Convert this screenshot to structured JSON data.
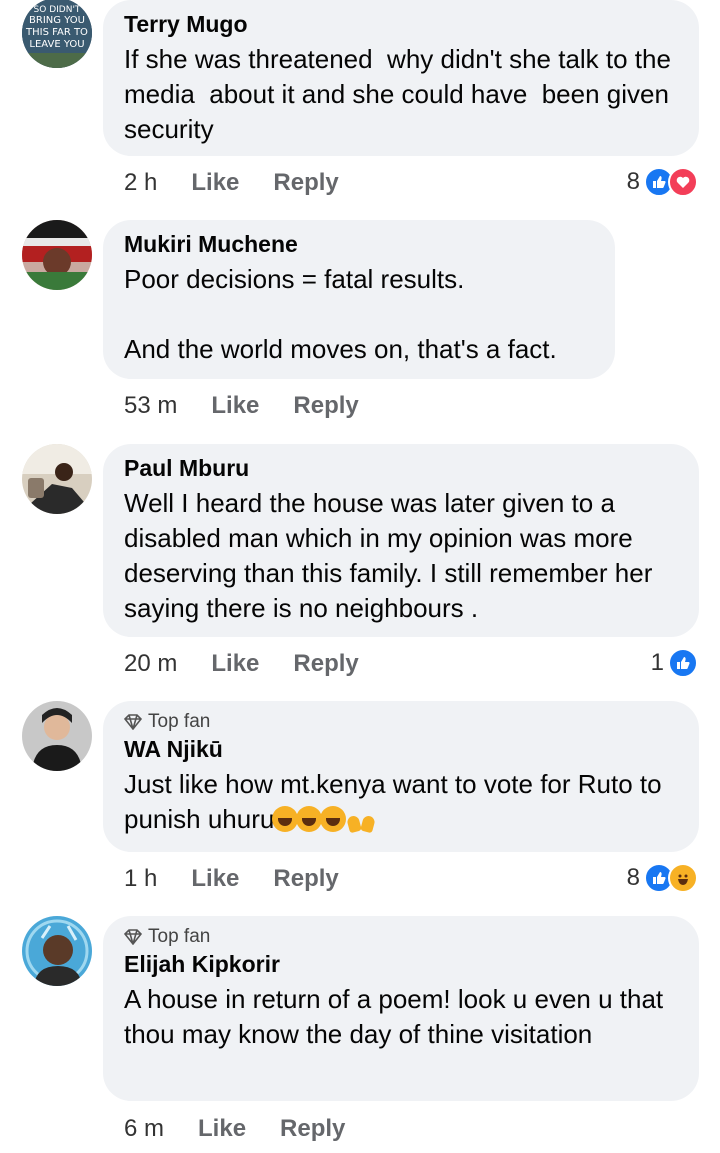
{
  "comments": [
    {
      "name": "Terry Mugo",
      "text": "If she was threatened  why didn't she talk to the media  about it and she could have  been given security",
      "time": "2 h",
      "like": "Like",
      "reply": "Reply",
      "reaction_count": "8",
      "reactions": [
        "like",
        "love"
      ],
      "avatar_text": "SO DIDN'T BRING YOU THIS FAR TO LEAVE YOU"
    },
    {
      "name": "Mukiri Muchene",
      "text": "Poor decisions = fatal results.\n\nAnd the world moves on, that's a fact.",
      "time": "53 m",
      "like": "Like",
      "reply": "Reply"
    },
    {
      "name": "Paul Mburu",
      "text": "Well I heard the house was later given to a disabled man which in my opinion was more deserving than this family. I still remember her saying there is no neighbours .",
      "time": "20 m",
      "like": "Like",
      "reply": "Reply",
      "reaction_count": "1",
      "reactions": [
        "like"
      ]
    },
    {
      "badge": "Top fan",
      "name": "WA Njikū",
      "text": "Just like how mt.kenya want to vote for Ruto to punish uhuru",
      "emojis": [
        "laughing-emoji",
        "laughing-emoji",
        "rolling-laughing-emoji",
        "raised-hands-emoji"
      ],
      "time": "1 h",
      "like": "Like",
      "reply": "Reply",
      "reaction_count": "8",
      "reactions": [
        "like",
        "haha"
      ]
    },
    {
      "badge": "Top fan",
      "name": "Elijah Kipkorir",
      "text": "A house in return of a poem! look u even u that thou may know the day of thine visitation",
      "time": "6 m",
      "like": "Like",
      "reply": "Reply"
    }
  ]
}
